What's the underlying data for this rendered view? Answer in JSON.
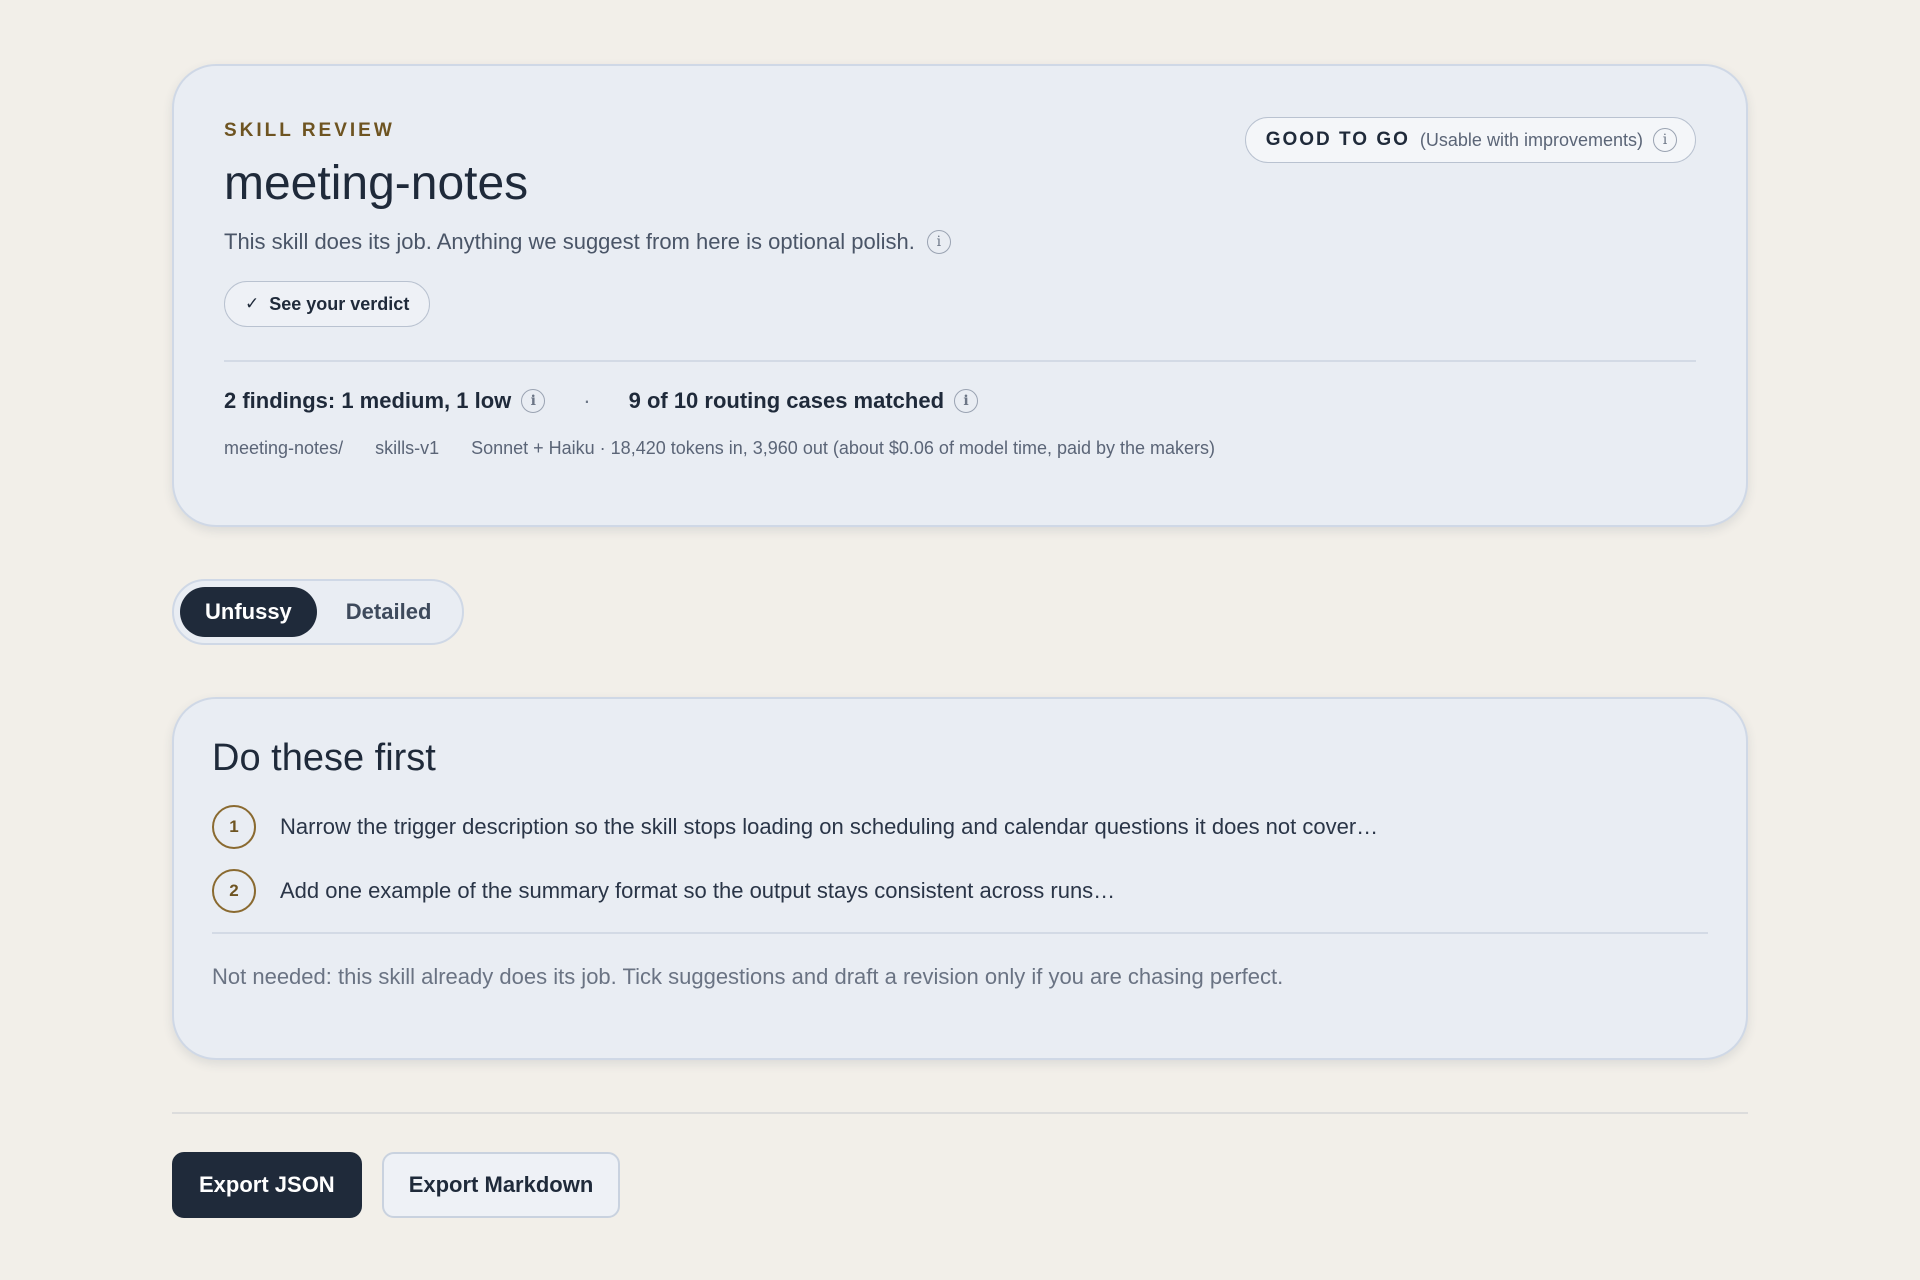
{
  "review": {
    "eyebrow": "SKILL REVIEW",
    "skill_name": "meeting-notes",
    "tagline": "This skill does its job. Anything we suggest from here is optional polish.",
    "verdict_button": "See your verdict",
    "badge": {
      "label": "GOOD TO GO",
      "sub": "(Usable with improvements)"
    },
    "findings": "2 findings: 1 medium, 1 low",
    "separator": "·",
    "routing": "9 of 10 routing cases matched",
    "meta": {
      "path": "meeting-notes/",
      "version": "skills-v1",
      "usage": "Sonnet + Haiku · 18,420 tokens in, 3,960 out (about $0.06 of model time, paid by the makers)"
    }
  },
  "view_toggle": {
    "options": [
      "Unfussy",
      "Detailed"
    ],
    "selected": "Unfussy"
  },
  "todo": {
    "title": "Do these first",
    "items": [
      {
        "number": "1",
        "text": "Narrow the trigger description so the skill stops loading on scheduling and calendar questions it does not cover…"
      },
      {
        "number": "2",
        "text": "Add one example of the summary format so the output stays consistent across runs…"
      }
    ],
    "note": "Not needed: this skill already does its job. Tick suggestions and draft a revision only if you are chasing perfect."
  },
  "actions": {
    "export_json": "Export JSON",
    "export_markdown": "Export Markdown"
  },
  "icons": {
    "info": "info-icon",
    "check": "check-icon"
  },
  "colors": {
    "background": "#f2efe9",
    "card": "#e9edf3",
    "primary": "#1f2a3a",
    "accent": "#6e5421"
  }
}
